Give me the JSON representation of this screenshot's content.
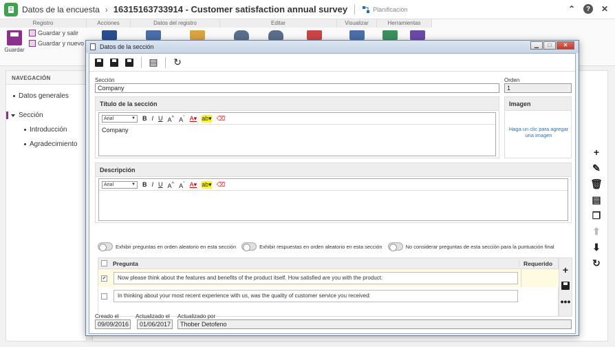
{
  "header": {
    "breadcrumb": "Datos de la encuesta",
    "title": "16315163733914 - Customer satisfaction annual survey",
    "planning_label": "Planificación"
  },
  "ribbon": {
    "groups": [
      "Registro",
      "Acciones",
      "Datos del registro",
      "Editar",
      "Visualizar",
      "Herramientas"
    ],
    "save_label": "Guardar",
    "save_exit_label": "Guardar y salir",
    "save_new_label": "Guardar y nuevo"
  },
  "nav": {
    "header": "NAVEGACIÓN",
    "items": [
      "Datos generales",
      "Sección",
      "Introducción",
      "Agradecimiento"
    ]
  },
  "dialog": {
    "title": "Datos de la sección",
    "seccion_label": "Sección",
    "seccion_value": "Company",
    "orden_label": "Orden",
    "orden_value": "1",
    "titulo_label": "Título de la sección",
    "titulo_text": "Company",
    "font_name": "Arial",
    "imagen_label": "Imagen",
    "imagen_link": "Haga un clic para agregar una imagen",
    "descripcion_label": "Descripción",
    "toggle1": "Exhibir preguntas en orden aleatorio en esta sección",
    "toggle2": "Exhibir respuestas en orden aleatorio en esta sección",
    "toggle3": "No considerar preguntas de esta sección para la puntuación final",
    "col_pregunta": "Pregunta",
    "col_requerido": "Requerido",
    "questions": [
      "Now please think about the features and benefits of the product itself. How satisfied are you with the product:",
      "In thinking about your most recent experience with us, was the quality of customer service you received:"
    ],
    "creado_label": "Creado el",
    "creado_value": "09/09/2016",
    "actualizado_label": "Actualizado el",
    "actualizado_value": "01/06/2017",
    "actualizado_por_label": "Actualizado por",
    "actualizado_por_value": "Thober Detofeno"
  },
  "colors": {
    "accent": "#8d2f8d",
    "logo": "#3ea34a",
    "link": "#2a6fb8"
  }
}
